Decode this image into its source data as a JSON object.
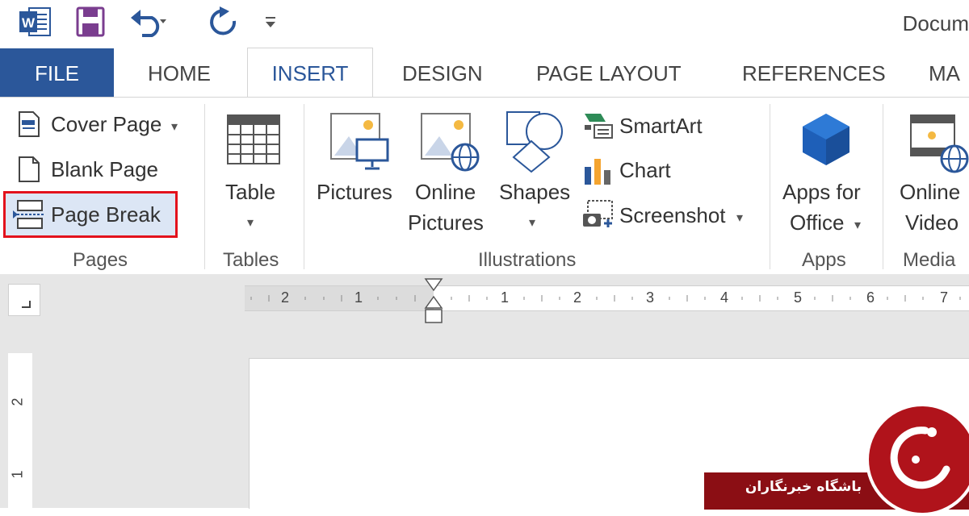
{
  "qat": {
    "doc_title": "Docum"
  },
  "tabs": [
    {
      "label": "FILE"
    },
    {
      "label": "HOME"
    },
    {
      "label": "INSERT"
    },
    {
      "label": "DESIGN"
    },
    {
      "label": "PAGE LAYOUT"
    },
    {
      "label": "REFERENCES"
    },
    {
      "label": "MA"
    }
  ],
  "ribbon": {
    "pages": {
      "cover_page": "Cover Page",
      "blank_page": "Blank Page",
      "page_break": "Page Break",
      "group": "Pages"
    },
    "tables": {
      "table": "Table",
      "group": "Tables"
    },
    "illustrations": {
      "pictures": "Pictures",
      "online_line1": "Online",
      "online_line2": "Pictures",
      "shapes": "Shapes",
      "smartart": "SmartArt",
      "chart": "Chart",
      "screenshot": "Screenshot",
      "group": "Illustrations"
    },
    "apps": {
      "line1": "Apps for",
      "line2": "Office",
      "group": "Apps"
    },
    "media": {
      "line1": "Online",
      "line2": "Video",
      "group": "Media"
    }
  },
  "ruler": {
    "left_labels": [
      "2",
      "1"
    ],
    "right_labels": [
      "1",
      "2",
      "3",
      "4",
      "5",
      "6",
      "7"
    ],
    "vertical_labels": [
      "2",
      "1"
    ]
  },
  "watermark": {
    "text": "باشگاه خبرنگاران"
  },
  "colors": {
    "file_tab": "#2b579a",
    "active_tab_text": "#2b579a",
    "highlight_border": "#e3121c",
    "highlight_fill": "#dce6f5",
    "watermark": "#b0131b"
  },
  "icons": [
    "word-logo-icon",
    "save-icon",
    "undo-icon",
    "redo-icon",
    "customize-qat-icon",
    "cover-page-icon",
    "blank-page-icon",
    "page-break-icon",
    "table-icon",
    "pictures-icon",
    "online-pictures-icon",
    "shapes-icon",
    "smartart-icon",
    "chart-icon",
    "screenshot-icon",
    "apps-for-office-icon",
    "online-video-icon"
  ]
}
